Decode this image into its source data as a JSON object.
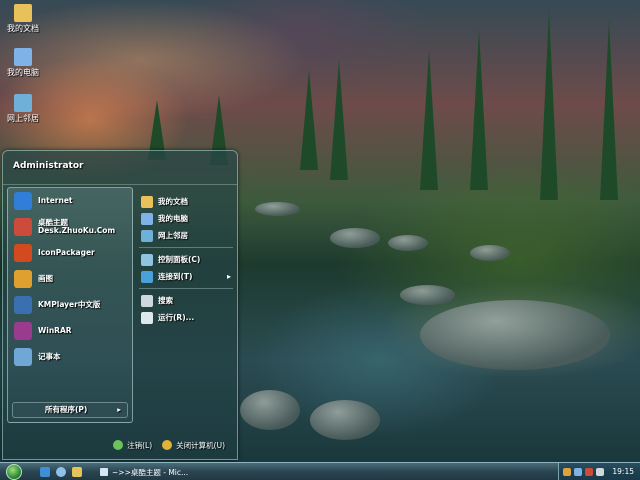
{
  "desktop": {
    "icons": [
      {
        "label": "我的文档",
        "icon": "folder-documents-icon",
        "color": "#e8c15a"
      },
      {
        "label": "我的电脑",
        "icon": "computer-icon",
        "color": "#7fb2e6"
      },
      {
        "label": "网上邻居",
        "icon": "network-icon",
        "color": "#6fb0d8"
      }
    ]
  },
  "start_menu": {
    "user": "Administrator",
    "pinned": [
      {
        "label": "Internet",
        "icon": "internet-explorer-icon",
        "color": "#2f7fd8"
      },
      {
        "label": "桌酷主题",
        "sub": "Desk.ZhuoKu.Com",
        "icon": "theme-icon",
        "color": "#cc4b3a"
      },
      {
        "label": "IconPackager",
        "icon": "iconpackager-icon",
        "color": "#d34a1f"
      },
      {
        "label": "画图",
        "icon": "paint-icon",
        "color": "#e0a030"
      },
      {
        "label": "KMPlayer中文版",
        "icon": "kmplayer-icon",
        "color": "#3a6fb0"
      },
      {
        "label": "WinRAR",
        "icon": "winrar-icon",
        "color": "#9b3b8e"
      },
      {
        "label": "记事本",
        "icon": "notepad-icon",
        "color": "#6fa7d6"
      }
    ],
    "all_programs": "所有程序(P)",
    "places": [
      {
        "label": "我的文档",
        "icon": "documents-icon",
        "color": "#e8c15a"
      },
      {
        "label": "我的电脑",
        "icon": "computer-icon",
        "color": "#7fb2e6"
      },
      {
        "label": "网上邻居",
        "icon": "network-icon",
        "color": "#6fb0d8"
      }
    ],
    "system": [
      {
        "label": "控制面板(C)",
        "icon": "control-panel-icon",
        "color": "#8fc3e0"
      },
      {
        "label": "连接到(T)",
        "icon": "connect-icon",
        "color": "#4aa0d8",
        "arrow": "▸"
      }
    ],
    "tools": [
      {
        "label": "搜索",
        "icon": "search-icon",
        "color": "#cfd8de"
      },
      {
        "label": "运行(R)...",
        "icon": "run-icon",
        "color": "#dfe8ec"
      }
    ],
    "footer": {
      "logoff": "注销(L)",
      "shutdown": "关闭计算机(U)",
      "logoff_color": "#6bc45a",
      "shutdown_color": "#e0b23a"
    }
  },
  "taskbar": {
    "task": "~>>桌酷主题 - Mic...",
    "clock": "19:15",
    "quick_launch": [
      "ie-icon",
      "media-icon",
      "folder-icon"
    ]
  }
}
